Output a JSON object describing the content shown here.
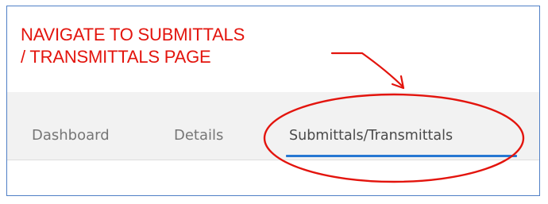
{
  "annotation": {
    "line1": "NAVIGATE TO SUBMITTALS",
    "line2": "/ TRANSMITTALS PAGE",
    "color": "#e3140d"
  },
  "nav": {
    "tabs": [
      {
        "label": "Dashboard",
        "active": false
      },
      {
        "label": "Details",
        "active": false
      },
      {
        "label": "Submittals/Transmittals",
        "active": true
      }
    ],
    "active_underline_color": "#2778d2",
    "background_color": "#f2f2f2"
  },
  "frame": {
    "border_color": "#4f7fc6"
  }
}
